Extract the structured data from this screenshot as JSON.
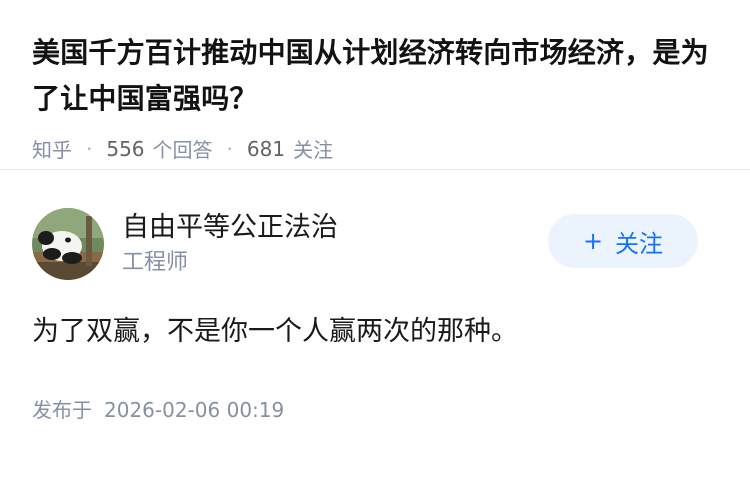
{
  "question": {
    "title": "美国千方百计推动中国从计划经济转向市场经济，是为了让中国富强吗？",
    "source": "知乎",
    "answers_count": "556",
    "answers_label": "个回答",
    "followers_count": "681",
    "followers_label": "关注"
  },
  "answer": {
    "author": {
      "name": "自由平等公正法治",
      "title": "工程师",
      "avatar": "panda-avatar"
    },
    "follow_button": {
      "icon": "+",
      "label": "关注"
    },
    "content": "为了双赢，不是你一个人赢两次的那种。",
    "publish_label": "发布于",
    "publish_time": "2026-02-06 00:19"
  },
  "colors": {
    "accent": "#1772f6",
    "follow_bg": "#ebf3fc",
    "meta": "#8590a6"
  }
}
